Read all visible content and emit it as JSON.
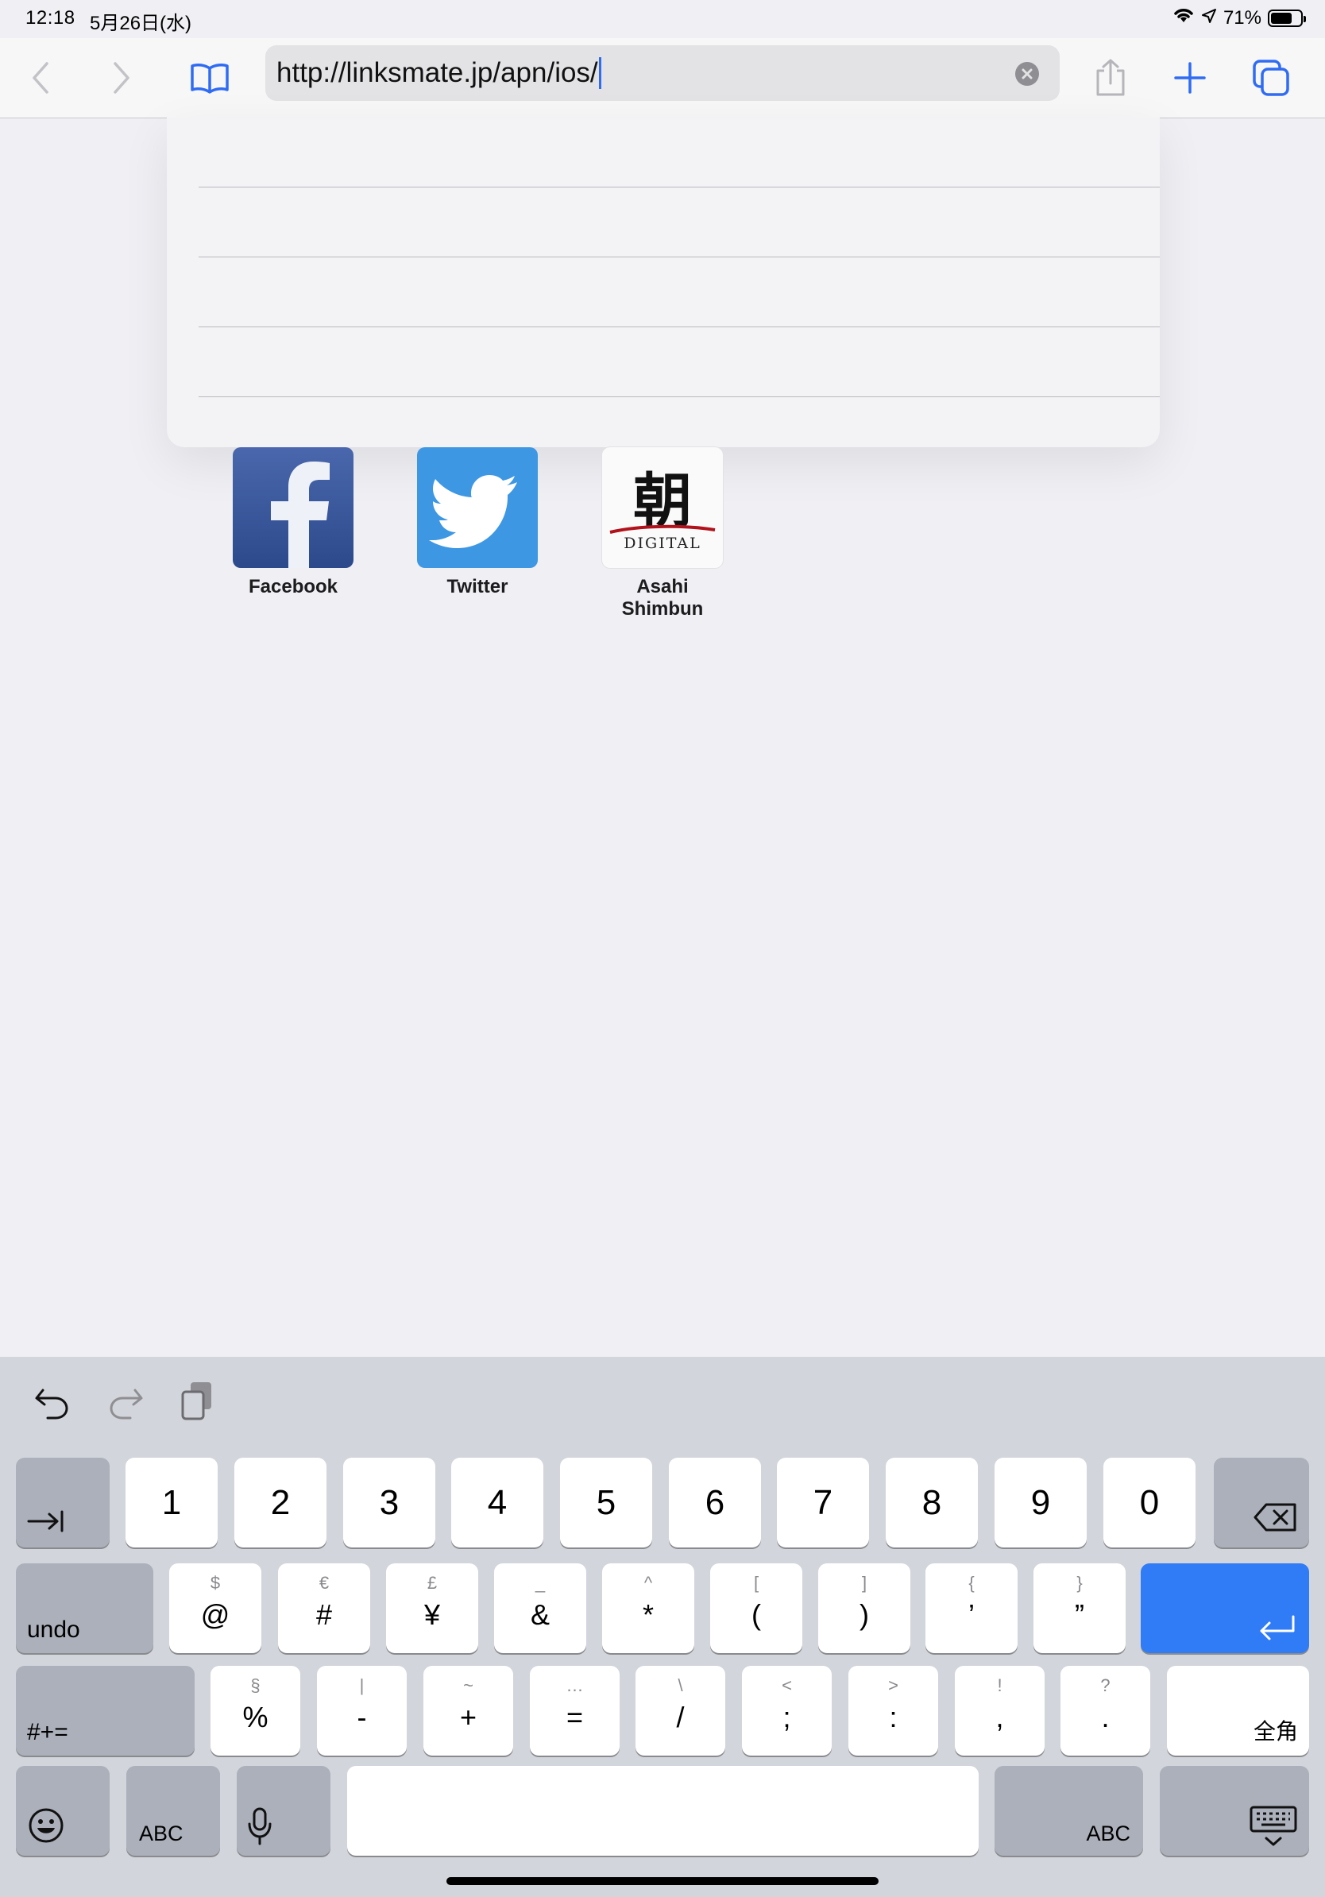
{
  "status_bar": {
    "time": "12:18",
    "date": "5月26日(水)",
    "battery_text": "71%",
    "battery_level": 0.71
  },
  "toolbar": {
    "url": "http://linksmate.jp/apn/ios/",
    "icons": [
      "back-icon",
      "forward-icon",
      "bookmarks-icon",
      "clear-icon",
      "share-icon",
      "new-tab-icon",
      "tabs-icon"
    ],
    "accent": "#2f6cf3"
  },
  "favorites": [
    {
      "label": "Facebook"
    },
    {
      "label": "Twitter"
    },
    {
      "label": "Asahi\nShimbun",
      "logo_kanji": "朝",
      "logo_text": "DIGITAL"
    }
  ],
  "keyboard": {
    "tools": [
      "undo-icon",
      "redo-icon",
      "paste-icon"
    ],
    "row1": {
      "keys": [
        "1",
        "2",
        "3",
        "4",
        "5",
        "6",
        "7",
        "8",
        "9",
        "0"
      ]
    },
    "row2": {
      "left": "undo",
      "keys": [
        {
          "main": "@",
          "sub": "$"
        },
        {
          "main": "#",
          "sub": "€"
        },
        {
          "main": "¥",
          "sub": "£"
        },
        {
          "main": "&",
          "sub": "_"
        },
        {
          "main": "*",
          "sub": "^"
        },
        {
          "main": "(",
          "sub": "["
        },
        {
          "main": ")",
          "sub": "]"
        },
        {
          "main": "’",
          "sub": "{"
        },
        {
          "main": "”",
          "sub": "}"
        }
      ]
    },
    "row3": {
      "left": "#+=",
      "keys": [
        {
          "main": "%",
          "sub": "§"
        },
        {
          "main": "-",
          "sub": "|"
        },
        {
          "main": "+",
          "sub": "~"
        },
        {
          "main": "=",
          "sub": "…"
        },
        {
          "main": "/",
          "sub": "\\"
        },
        {
          "main": ";",
          "sub": "<"
        },
        {
          "main": ":",
          "sub": ">"
        },
        {
          "main": ",",
          "sub": "!"
        },
        {
          "main": ".",
          "sub": "?"
        }
      ],
      "right": "全角"
    },
    "row4": {
      "abc_left": "ABC",
      "abc_right": "ABC"
    }
  }
}
